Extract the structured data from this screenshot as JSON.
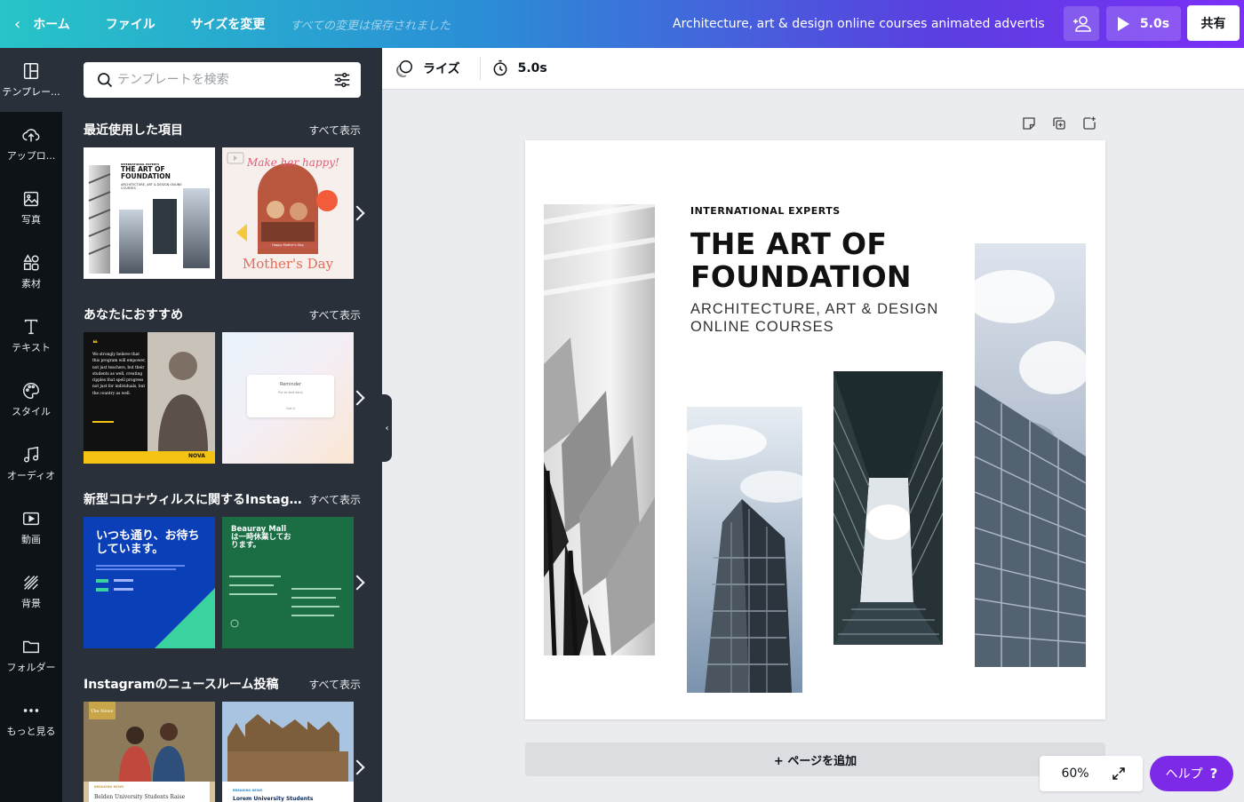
{
  "topbar": {
    "home": "ホーム",
    "file": "ファイル",
    "resize": "サイズを変更",
    "saved_status": "すべての変更は保存されました",
    "title": "Architecture, art & design online courses animated advertis...",
    "play_duration": "5.0s",
    "share": "共有"
  },
  "rail": {
    "items": [
      {
        "label": "テンプレー...",
        "icon": "template-icon"
      },
      {
        "label": "アップロ...",
        "icon": "upload-icon"
      },
      {
        "label": "写真",
        "icon": "photo-icon"
      },
      {
        "label": "素材",
        "icon": "elements-icon"
      },
      {
        "label": "テキスト",
        "icon": "text-icon"
      },
      {
        "label": "スタイル",
        "icon": "palette-icon"
      },
      {
        "label": "オーディオ",
        "icon": "audio-icon"
      },
      {
        "label": "動画",
        "icon": "video-icon"
      },
      {
        "label": "背景",
        "icon": "background-icon"
      },
      {
        "label": "フォルダー",
        "icon": "folder-icon"
      },
      {
        "label": "もっと見る",
        "icon": "more-icon"
      }
    ]
  },
  "panel": {
    "search_placeholder": "テンプレートを検索",
    "sections": [
      {
        "title": "最近使用した項目",
        "see_all": "すべて表示",
        "thumbs": [
          {
            "kicker": "INTERNATIONAL EXPERTS",
            "title": "THE ART OF FOUNDATION",
            "sub": "ARCHITECTURE, ART & DESIGN ONLINE COURSES"
          },
          {
            "script": "Make her happy!",
            "sub": "Mother's Day",
            "tag": "Happy Mother's Day"
          }
        ]
      },
      {
        "title": "あなたにおすすめ",
        "see_all": "すべて表示",
        "thumbs": [
          {
            "quote": "We strongly believe that this program will empower, not just teachers, but their students as well, creating ripples that spell progress not just for individuals, but the country as well.",
            "name": "NOVA"
          },
          {
            "title": "Reminder",
            "body": "Put to bed early",
            "btn": "Got it"
          }
        ]
      },
      {
        "title": "新型コロナウィルスに関するInstagr...",
        "see_all": "すべて表示",
        "thumbs": [
          {
            "title": "いつも通り、お待ちしています。"
          },
          {
            "title": "Beauray Mallは一時休業しております。"
          }
        ]
      },
      {
        "title": "Instagramのニュースルーム投稿",
        "see_all": "すべて表示",
        "thumbs": [
          {
            "badge": "The News",
            "label": "BREAKING NEWS",
            "headline": "Belden University Students Raise"
          },
          {
            "label": "BREAKING NEWS",
            "headline": "Lorem University Students"
          }
        ]
      }
    ]
  },
  "toolbar": {
    "animation": "ライズ",
    "duration": "5.0s"
  },
  "design": {
    "kicker": "INTERNATIONAL EXPERTS",
    "headline_1": "THE ART OF",
    "headline_2": "FOUNDATION",
    "sub_1": "ARCHITECTURE, ART & DESIGN",
    "sub_2": "ONLINE COURSES"
  },
  "canvas": {
    "add_page": "+ ページを追加",
    "zoom": "60%",
    "help": "ヘルプ",
    "help_q": "?"
  },
  "colors": {
    "accent": "#7d2ae8",
    "rail_bg": "#0e1318",
    "panel_bg": "#293039"
  }
}
